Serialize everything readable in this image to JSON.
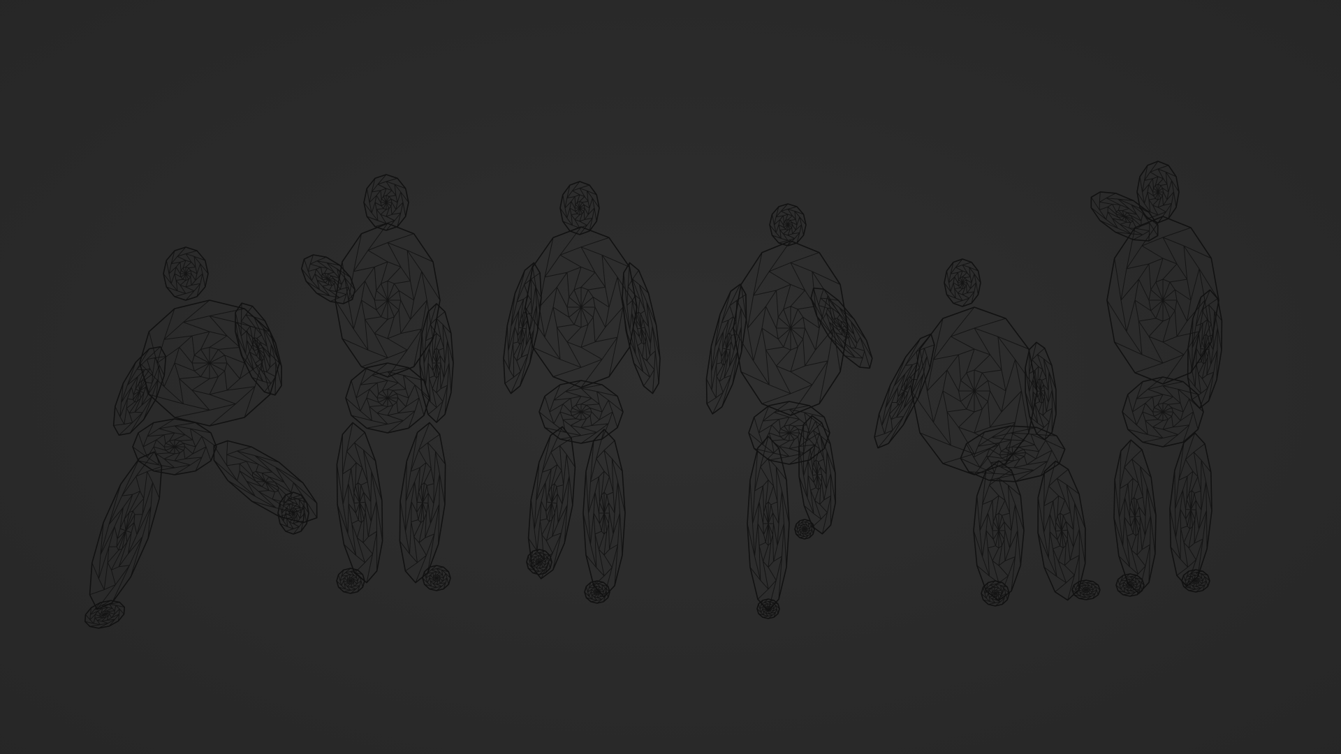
{
  "scene": {
    "background": "#2f2f2f",
    "vignette": "#262626",
    "wire_color": "#111111",
    "figure_count": 6,
    "figures": [
      {
        "pose": "crouch-lunge"
      },
      {
        "pose": "standing-arm-raised"
      },
      {
        "pose": "walking-forward"
      },
      {
        "pose": "walking-back-view"
      },
      {
        "pose": "seated-knee-up"
      },
      {
        "pose": "standing-hand-on-head"
      }
    ]
  }
}
